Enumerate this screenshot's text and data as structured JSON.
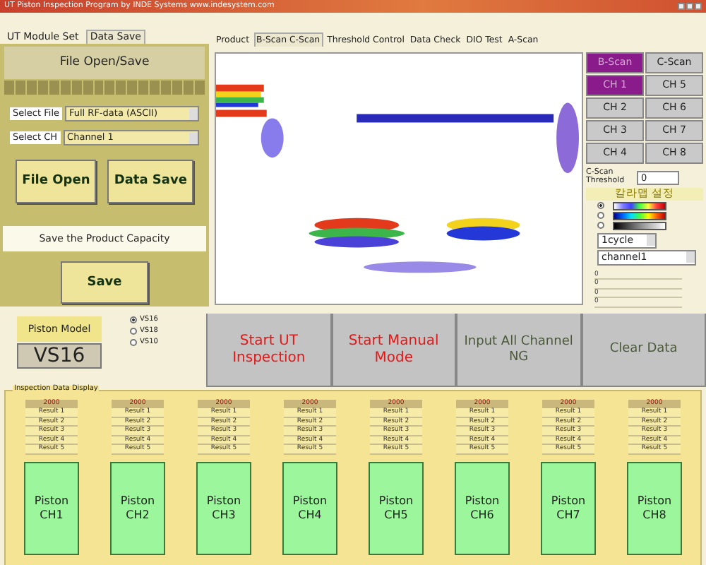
{
  "window": {
    "title": "UT Piston Inspection Program by INDE Systems www.indesystem.com"
  },
  "left_tabs": [
    {
      "label": "UT Module Set",
      "selected": false
    },
    {
      "label": "Data Save",
      "selected": true
    }
  ],
  "file_panel": {
    "heading": "File Open/Save",
    "selects": [
      {
        "label": "Select File",
        "value": "Full RF-data (ASCII)"
      },
      {
        "label": "Select CH",
        "value": "Channel 1"
      }
    ],
    "buttons": [
      "File Open",
      "Data Save"
    ],
    "capacity_label": "Save the Product Capacity",
    "save_button": "Save"
  },
  "main_tabs": [
    {
      "label": "Product",
      "selected": false
    },
    {
      "label": "B-Scan C-Scan",
      "selected": true
    },
    {
      "label": "Threshold Control",
      "selected": false
    },
    {
      "label": "Data Check",
      "selected": false
    },
    {
      "label": "DIO Test",
      "selected": false
    },
    {
      "label": "A-Scan",
      "selected": false
    }
  ],
  "scan_buttons": [
    {
      "label": "B-Scan",
      "selected": true
    },
    {
      "label": "C-Scan",
      "selected": false
    }
  ],
  "channels": [
    {
      "label": "CH 1",
      "selected": true
    },
    {
      "label": "CH 2",
      "selected": false
    },
    {
      "label": "CH 3",
      "selected": false
    },
    {
      "label": "CH 4",
      "selected": false
    },
    {
      "label": "CH 5",
      "selected": false
    },
    {
      "label": "CH 6",
      "selected": false
    },
    {
      "label": "CH 7",
      "selected": false
    },
    {
      "label": "CH 8",
      "selected": false
    }
  ],
  "threshold": {
    "label": "C-Scan Threshold",
    "value": "0"
  },
  "color_map": {
    "title": "칼라맵 설정",
    "options": [
      {
        "kind": "spectrum",
        "selected": true
      },
      {
        "kind": "jet",
        "selected": false
      },
      {
        "kind": "gray",
        "selected": false
      }
    ]
  },
  "cycle_select": "1cycle",
  "channel_select": "channel1",
  "readouts": [
    "0",
    "0",
    "0",
    "0"
  ],
  "piston_model": {
    "label": "Piston Model",
    "value": "VS16",
    "options": [
      {
        "label": "VS16",
        "selected": true
      },
      {
        "label": "VS18",
        "selected": false
      },
      {
        "label": "VS10",
        "selected": false
      }
    ]
  },
  "actions": [
    {
      "label": "Start UT Inspection",
      "kind": "start"
    },
    {
      "label": "Start Manual Mode",
      "kind": "start"
    },
    {
      "label": "Input All Channel NG",
      "kind": "plain"
    },
    {
      "label": "Clear Data",
      "kind": "plain"
    }
  ],
  "inspection": {
    "title": "Inspection Data Display",
    "channels": [
      {
        "value": "2000",
        "results": [
          "Result 1",
          "Result 2",
          "Result 3",
          "Result 4",
          "Result 5"
        ],
        "label": "Piston CH1"
      },
      {
        "value": "2000",
        "results": [
          "Result 1",
          "Result 2",
          "Result 3",
          "Result 4",
          "Result 5"
        ],
        "label": "Piston CH2"
      },
      {
        "value": "2000",
        "results": [
          "Result 1",
          "Result 2",
          "Result 3",
          "Result 4",
          "Result 5"
        ],
        "label": "Piston CH3"
      },
      {
        "value": "2000",
        "results": [
          "Result 1",
          "Result 2",
          "Result 3",
          "Result 4",
          "Result 5"
        ],
        "label": "Piston CH4"
      },
      {
        "value": "2000",
        "results": [
          "Result 1",
          "Result 2",
          "Result 3",
          "Result 4",
          "Result 5"
        ],
        "label": "Piston CH5"
      },
      {
        "value": "2000",
        "results": [
          "Result 1",
          "Result 2",
          "Result 3",
          "Result 4",
          "Result 5"
        ],
        "label": "Piston CH6"
      },
      {
        "value": "2000",
        "results": [
          "Result 1",
          "Result 2",
          "Result 3",
          "Result 4",
          "Result 5"
        ],
        "label": "Piston CH7"
      },
      {
        "value": "2000",
        "results": [
          "Result 1",
          "Result 2",
          "Result 3",
          "Result 4",
          "Result 5"
        ],
        "label": "Piston CH8"
      }
    ]
  }
}
